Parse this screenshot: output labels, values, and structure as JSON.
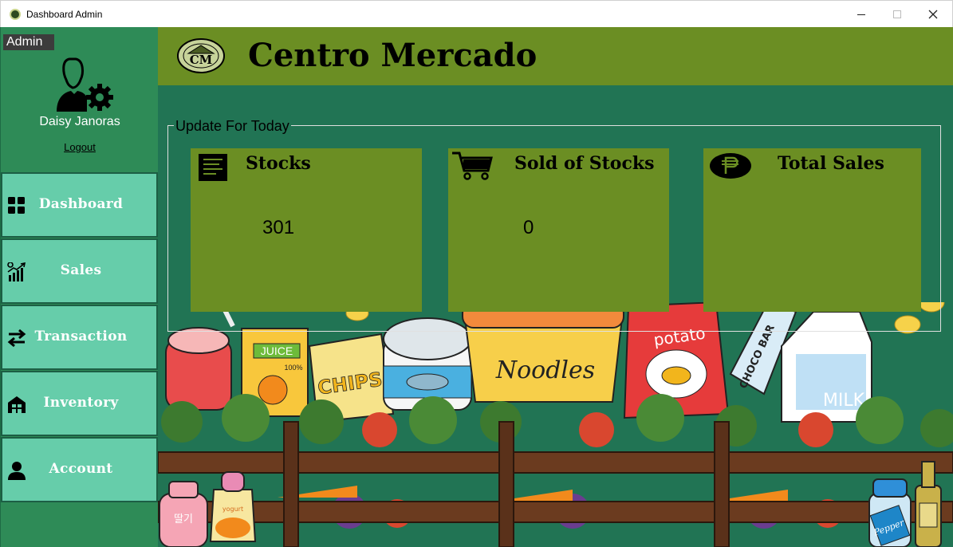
{
  "window": {
    "title": "Dashboard Admin"
  },
  "sidebar": {
    "role": "Admin",
    "user_name": "Daisy Janoras",
    "logout_label": "Logout",
    "items": [
      {
        "label": "Dashboard",
        "icon": "dashboard-grid-icon"
      },
      {
        "label": "Sales",
        "icon": "sales-chart-icon"
      },
      {
        "label": "Transaction",
        "icon": "transfer-arrows-icon"
      },
      {
        "label": "Inventory",
        "icon": "warehouse-icon"
      },
      {
        "label": "Account",
        "icon": "user-icon"
      }
    ]
  },
  "header": {
    "logo_text": "CM",
    "brand": "Centro Mercado"
  },
  "dashboard": {
    "group_title": "Update For Today",
    "cards": [
      {
        "title": "Stocks",
        "value": "301",
        "icon": "receipt-icon"
      },
      {
        "title": "Sold of Stocks",
        "value": "0",
        "icon": "cart-icon"
      },
      {
        "title": "Total Sales",
        "value": "",
        "icon": "peso-icon"
      }
    ]
  },
  "illustration": {
    "labels": [
      "JUICE",
      "100%",
      "CHIPS",
      "Noodles",
      "potato",
      "CHOCO BAR",
      "MILK",
      "Pepper",
      "딸기",
      "yogurt"
    ]
  },
  "colors": {
    "sidebar": "#2e8b57",
    "nav_item": "#66cdaa",
    "header": "#6b8e23",
    "main_bg": "#217454",
    "card": "#6b8e23"
  }
}
